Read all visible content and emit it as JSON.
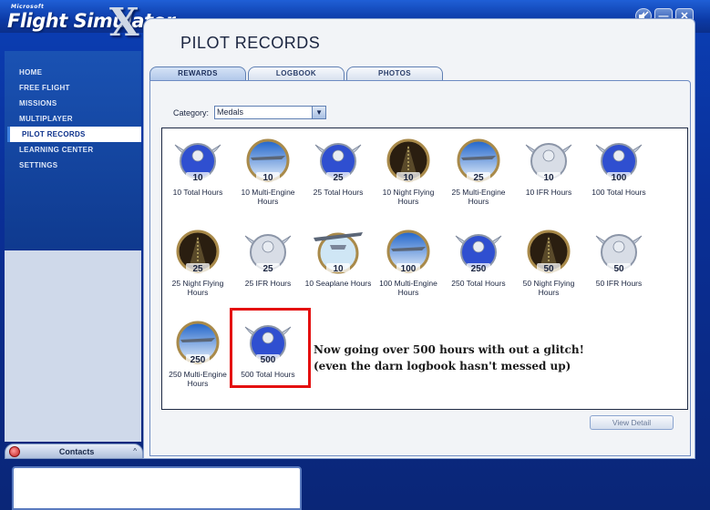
{
  "app": {
    "brand_small": "Microsoft",
    "brand_main": "Flight Simulator",
    "brand_x": "X"
  },
  "window_controls": {
    "sound_icon": "mute-icon",
    "minimize_label": "—",
    "close_label": "✕"
  },
  "sidebar": {
    "items": [
      {
        "label": "HOME",
        "active": false
      },
      {
        "label": "FREE FLIGHT",
        "active": false
      },
      {
        "label": "MISSIONS",
        "active": false
      },
      {
        "label": "MULTIPLAYER",
        "active": false
      },
      {
        "label": "PILOT RECORDS",
        "active": true
      },
      {
        "label": "LEARNING CENTER",
        "active": false
      },
      {
        "label": "SETTINGS",
        "active": false
      }
    ],
    "contacts_label": "Contacts"
  },
  "main": {
    "title": "PILOT RECORDS",
    "tabs": [
      {
        "label": "REWARDS",
        "active": true
      },
      {
        "label": "LOGBOOK",
        "active": false
      },
      {
        "label": "PHOTOS",
        "active": false
      }
    ],
    "category_label": "Category:",
    "category_value": "Medals",
    "view_detail_label": "View Detail"
  },
  "medals": [
    {
      "name": "10 Total Hours",
      "number": "10",
      "style": "wings-blue"
    },
    {
      "name": "10 Multi-Engine Hours",
      "number": "10",
      "style": "sky-plane"
    },
    {
      "name": "25 Total Hours",
      "number": "25",
      "style": "wings-blue"
    },
    {
      "name": "10 Night Flying Hours",
      "number": "10",
      "style": "night"
    },
    {
      "name": "25 Multi-Engine Hours",
      "number": "25",
      "style": "sky-plane"
    },
    {
      "name": "10 IFR Hours",
      "number": "10",
      "style": "wings-gray"
    },
    {
      "name": "100 Total Hours",
      "number": "100",
      "style": "wings-blue"
    },
    {
      "name": "25 Night Flying Hours",
      "number": "25",
      "style": "night"
    },
    {
      "name": "25 IFR Hours",
      "number": "25",
      "style": "wings-gray"
    },
    {
      "name": "10 Seaplane Hours",
      "number": "10",
      "style": "seaplane"
    },
    {
      "name": "100 Multi-Engine Hours",
      "number": "100",
      "style": "sky-plane"
    },
    {
      "name": "250 Total Hours",
      "number": "250",
      "style": "wings-blue"
    },
    {
      "name": "50 Night Flying Hours",
      "number": "50",
      "style": "night"
    },
    {
      "name": "50 IFR Hours",
      "number": "50",
      "style": "wings-gray"
    },
    {
      "name": "250 Multi-Engine Hours",
      "number": "250",
      "style": "sky-plane"
    },
    {
      "name": "500 Total Hours",
      "number": "500",
      "style": "wings-blue"
    }
  ],
  "annotation": {
    "line1": "Now going over 500 hours with out a glitch!",
    "line2": "(even the darn logbook hasn't messed up)",
    "highlight_color": "#e41010"
  },
  "colors": {
    "frame_blue": "#0b3fb5",
    "panel_bg": "#f2f4f7"
  }
}
